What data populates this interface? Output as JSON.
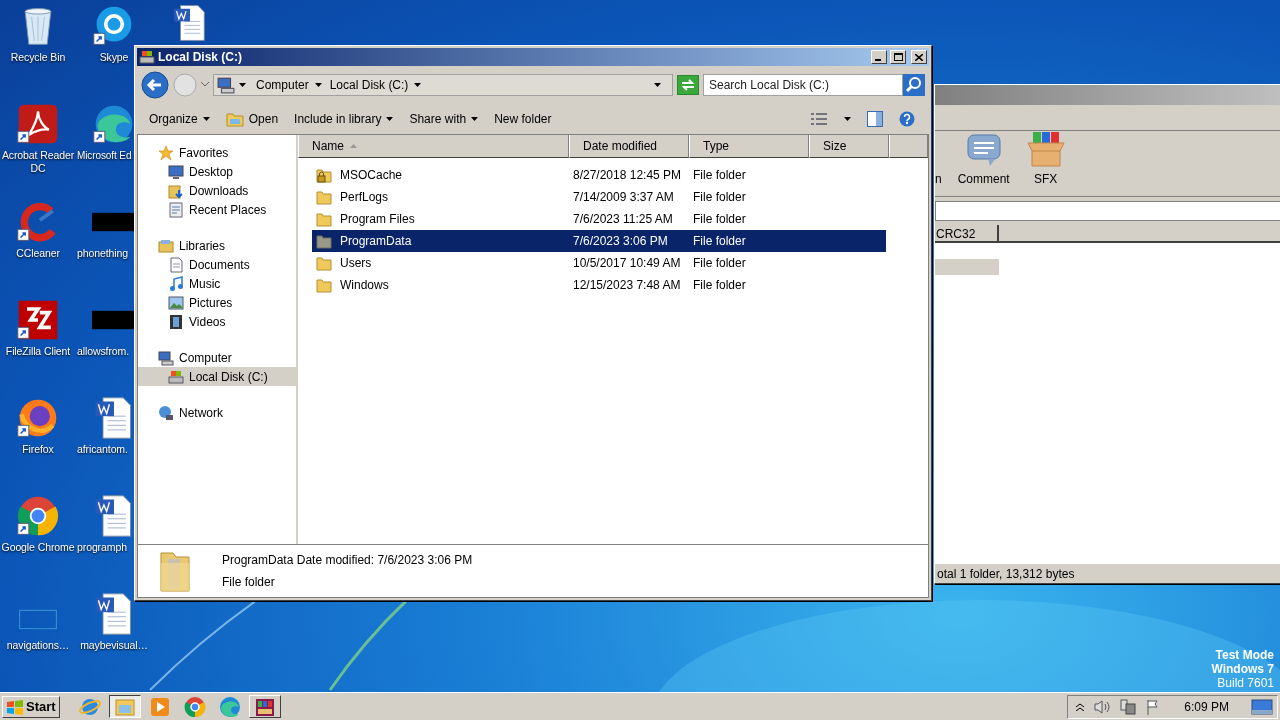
{
  "desktop": {
    "columns": [
      [
        {
          "label": "Recycle Bin",
          "kind": "recycle",
          "shortcut": false
        },
        {
          "label": "Acrobat Reader DC",
          "kind": "acrobat",
          "shortcut": true
        },
        {
          "label": "CCleaner",
          "kind": "ccleaner",
          "shortcut": true
        },
        {
          "label": "FileZilla Client",
          "kind": "filezilla",
          "shortcut": true
        },
        {
          "label": "Firefox",
          "kind": "firefox",
          "shortcut": true
        },
        {
          "label": "Google Chrome",
          "kind": "chrome",
          "shortcut": true
        },
        {
          "label": "navigations…",
          "kind": "blank",
          "shortcut": false
        }
      ],
      [
        {
          "label": "Skype",
          "kind": "skype",
          "shortcut": true
        },
        {
          "label": "Microsoft Ed",
          "kind": "edge",
          "shortcut": true
        },
        {
          "label": "phonething",
          "kind": "redacted",
          "shortcut": false
        },
        {
          "label": "allowsfrom.",
          "kind": "redacted",
          "shortcut": false
        },
        {
          "label": "africantom.",
          "kind": "word",
          "shortcut": false
        },
        {
          "label": "programph",
          "kind": "word",
          "shortcut": false
        },
        {
          "label": "maybevisual…",
          "kind": "word",
          "shortcut": false
        }
      ],
      [
        {
          "kind": "word",
          "shortcut": false
        }
      ]
    ],
    "os_notice": [
      "Test Mode",
      "Windows 7",
      "Build 7601"
    ]
  },
  "background_window": {
    "toolbar": [
      {
        "label": "n",
        "kind": "partial"
      },
      {
        "label": "Comment",
        "kind": "comment"
      },
      {
        "label": "SFX",
        "kind": "sfx"
      }
    ],
    "columns": [
      "CRC32"
    ],
    "status": "otal 1 folder, 13,312 bytes"
  },
  "explorer": {
    "title": "Local Disk (C:)",
    "breadcrumbs": [
      "Computer",
      "Local Disk (C:)"
    ],
    "search": {
      "placeholder": "Search Local Disk (C:)"
    },
    "toolbar": [
      {
        "label": "Organize",
        "kind": "menu"
      },
      {
        "label": "Open",
        "kind": "open"
      },
      {
        "label": "Include in library",
        "kind": "menu"
      },
      {
        "label": "Share with",
        "kind": "menu"
      },
      {
        "label": "New folder",
        "kind": "plain"
      }
    ],
    "nav": [
      {
        "label": "Favorites",
        "kind": "star",
        "selected": false,
        "children": [
          {
            "label": "Desktop",
            "kind": "desktop",
            "selected": false
          },
          {
            "label": "Downloads",
            "kind": "downloads",
            "selected": false
          },
          {
            "label": "Recent Places",
            "kind": "recent",
            "selected": false
          }
        ]
      },
      {
        "label": "Libraries",
        "kind": "libraries",
        "selected": false,
        "children": [
          {
            "label": "Documents",
            "kind": "documents",
            "selected": false
          },
          {
            "label": "Music",
            "kind": "music",
            "selected": false
          },
          {
            "label": "Pictures",
            "kind": "pictures",
            "selected": false
          },
          {
            "label": "Videos",
            "kind": "videos",
            "selected": false
          }
        ]
      },
      {
        "label": "Computer",
        "kind": "computer",
        "selected": false,
        "children": [
          {
            "label": "Local Disk (C:)",
            "kind": "drive",
            "selected": true
          }
        ]
      },
      {
        "label": "Network",
        "kind": "network",
        "selected": false
      }
    ],
    "columns": [
      {
        "label": "Name",
        "sorted": true
      },
      {
        "label": "Date modified",
        "sorted": false
      },
      {
        "label": "Type",
        "sorted": false
      },
      {
        "label": "Size",
        "sorted": false
      }
    ],
    "rows": [
      {
        "name": "MSOCache",
        "date": "8/27/2018 12:45 PM",
        "type": "File folder",
        "kind": "locked",
        "selected": false
      },
      {
        "name": "PerfLogs",
        "date": "7/14/2009 3:37 AM",
        "type": "File folder",
        "kind": "folder",
        "selected": false
      },
      {
        "name": "Program Files",
        "date": "7/6/2023 11:25 AM",
        "type": "File folder",
        "kind": "folder",
        "selected": false
      },
      {
        "name": "ProgramData",
        "date": "7/6/2023 3:06 PM",
        "type": "File folder",
        "kind": "hidden",
        "selected": true
      },
      {
        "name": "Users",
        "date": "10/5/2017 10:49 AM",
        "type": "File folder",
        "kind": "folder",
        "selected": false
      },
      {
        "name": "Windows",
        "date": "12/15/2023 7:48 AM",
        "type": "File folder",
        "kind": "folder",
        "selected": false
      }
    ],
    "details": {
      "name": "ProgramData",
      "date_label": "Date modified:",
      "date": "7/6/2023 3:06 PM",
      "type": "File folder"
    }
  },
  "taskbar": {
    "start": "Start",
    "apps": [
      {
        "kind": "ie",
        "selected": false,
        "running": false
      },
      {
        "kind": "explorer",
        "selected": true,
        "running": true
      },
      {
        "kind": "media",
        "selected": false,
        "running": false
      },
      {
        "kind": "chrome",
        "selected": false,
        "running": false
      },
      {
        "kind": "edge",
        "selected": false,
        "running": false
      },
      {
        "kind": "winrar",
        "selected": false,
        "running": true
      }
    ],
    "clock": "6:09 PM"
  }
}
